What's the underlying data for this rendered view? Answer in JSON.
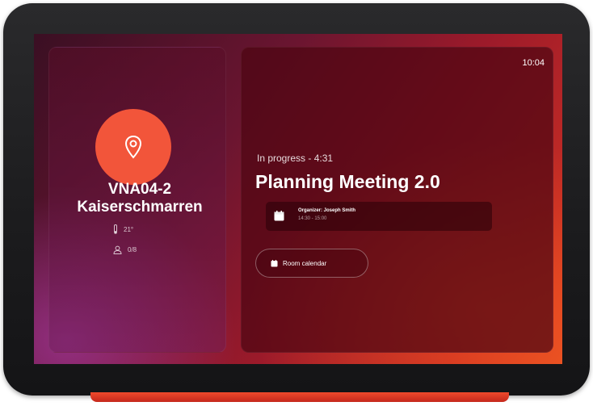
{
  "room": {
    "line1": "VNA04-2",
    "line2": "Kaiserschmarren",
    "temperature": "21°",
    "occupancy": "0/8"
  },
  "clock": "10:04",
  "meeting": {
    "status": "In progress - 4:31",
    "title": "Planning Meeting 2.0",
    "organizer": "Organizer: Joseph Smith",
    "time": "14:30 - 15:00"
  },
  "buttons": {
    "room_calendar": "Room calendar"
  },
  "colors": {
    "accent": "#f2553a"
  },
  "icons": {
    "location": "location-pin-icon",
    "temperature": "thermometer-icon",
    "people": "person-icon",
    "calendar": "calendar-icon"
  }
}
